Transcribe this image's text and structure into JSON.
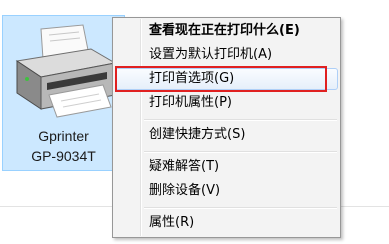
{
  "device": {
    "name_line1": "Gprinter",
    "name_line2": "GP-9034T",
    "icon": "printer-icon"
  },
  "context_menu": {
    "items": [
      {
        "label": "查看现在正在打印什么(E)",
        "bold": true
      },
      {
        "label": "设置为默认打印机(A)"
      },
      {
        "label": "打印首选项(G)",
        "highlighted": true
      },
      {
        "label": "打印机属性(P)"
      },
      {
        "label": "创建快捷方式(S)"
      },
      {
        "label": "疑难解答(T)"
      },
      {
        "label": "删除设备(V)"
      },
      {
        "label": "属性(R)"
      }
    ]
  },
  "colors": {
    "selection": "#cce8ff",
    "highlight_border": "#e02020",
    "menu_background": "#f3f3f3"
  }
}
